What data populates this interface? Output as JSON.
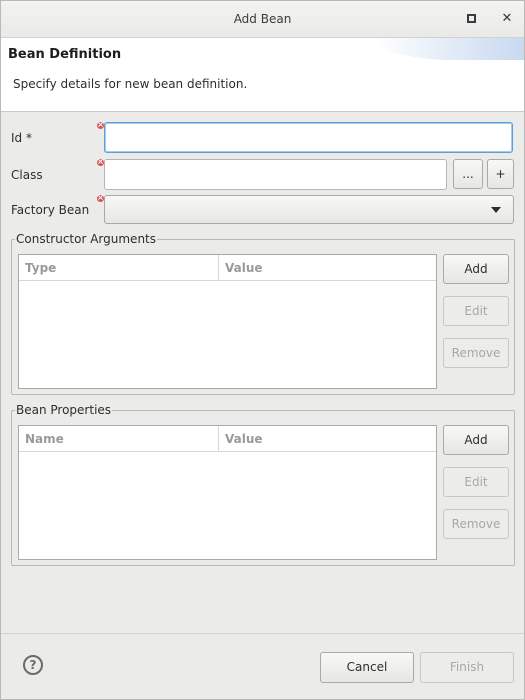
{
  "window": {
    "title": "Add Bean"
  },
  "header": {
    "title": "Bean Definition",
    "description": "Specify details for new bean definition."
  },
  "form": {
    "id_label": "Id *",
    "id_value": "",
    "class_label": "Class",
    "class_value": "",
    "browse_label": "...",
    "add_class_label": "+",
    "factory_label": "Factory Bean",
    "factory_value": ""
  },
  "constructor_args": {
    "legend": "Constructor Arguments",
    "columns": [
      "Type",
      "Value"
    ],
    "rows": [],
    "add_label": "Add",
    "edit_label": "Edit",
    "remove_label": "Remove"
  },
  "bean_properties": {
    "legend": "Bean Properties",
    "columns": [
      "Name",
      "Value"
    ],
    "rows": [],
    "add_label": "Add",
    "edit_label": "Edit",
    "remove_label": "Remove"
  },
  "footer": {
    "help_label": "?",
    "cancel_label": "Cancel",
    "finish_label": "Finish"
  },
  "icons": {
    "maximize": "maximize-icon",
    "close": "close-icon",
    "error": "error-decorator-icon",
    "dropdown": "chevron-down-icon",
    "help": "help-icon"
  }
}
